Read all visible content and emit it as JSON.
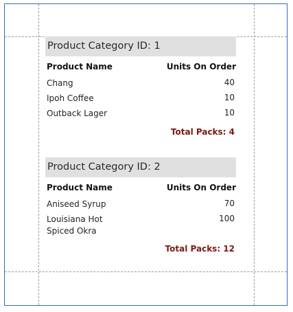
{
  "groups": [
    {
      "header": "Product Category ID: 1",
      "columns": {
        "name": "Product Name",
        "units": "Units On Order"
      },
      "rows": [
        {
          "name": "Chang",
          "units": "40"
        },
        {
          "name": "Ipoh Coffee",
          "units": "10"
        },
        {
          "name": "Outback Lager",
          "units": "10"
        }
      ],
      "total": "Total Packs: 4"
    },
    {
      "header": "Product Category ID: 2",
      "columns": {
        "name": "Product Name",
        "units": "Units On Order"
      },
      "rows": [
        {
          "name": "Aniseed Syrup",
          "units": "70"
        },
        {
          "name": "Louisiana Hot Spiced Okra",
          "units": "100"
        }
      ],
      "total": "Total Packs: 12"
    }
  ],
  "colors": {
    "frame": "#2e6bc4",
    "header_bg": "#e0e0e0",
    "total_text": "#7a1a12",
    "guides": "#9a9a9a"
  }
}
